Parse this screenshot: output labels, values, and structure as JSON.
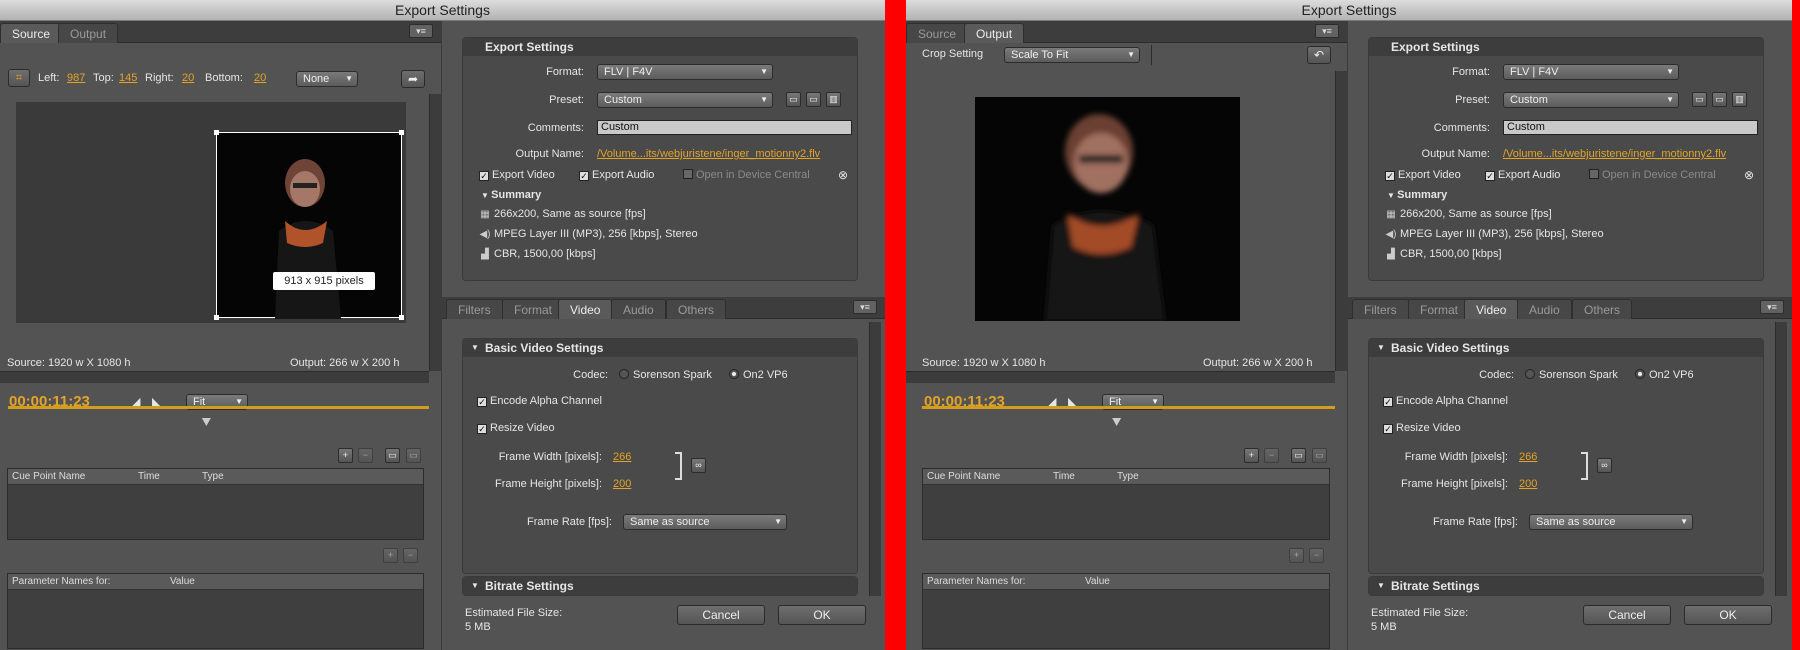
{
  "windows": [
    {
      "title": "Export Settings",
      "left_tabs": [
        "Source",
        "Output"
      ],
      "active_left_tab": 0,
      "crop": {
        "left_label": "Left:",
        "left": "987",
        "top_label": "Top:",
        "top": "145",
        "right_label": "Right:",
        "right": "20",
        "bottom_label": "Bottom:",
        "bottom": "20",
        "ratio": "None"
      },
      "crop_tooltip": "913 x 915 pixels",
      "source_info": "Source: 1920 w X 1080 h",
      "output_info": "Output: 266 w X 200 h",
      "timecode": "00;00;11;23",
      "zoom": "Fit",
      "playhead_position": 0.47,
      "cue_headers": [
        "Cue Point Name",
        "Time",
        "Type"
      ],
      "param_headers": [
        "Parameter Names for:",
        "Value"
      ],
      "export_settings": {
        "header": "Export Settings",
        "format_label": "Format:",
        "format": "FLV | F4V",
        "preset_label": "Preset:",
        "preset": "Custom",
        "comments_label": "Comments:",
        "comments": "Custom",
        "output_name_label": "Output Name:",
        "output_name": "/Volume...its/webjuristene/inger_motionny2.flv",
        "export_video": "Export Video",
        "export_audio": "Export Audio",
        "device_central": "Open in Device Central",
        "summary_label": "Summary",
        "summary": [
          "266x200, Same as source [fps]",
          "MPEG Layer III (MP3), 256 [kbps], Stereo",
          "CBR, 1500,00 [kbps]"
        ]
      },
      "right_tabs": [
        "Filters",
        "Format",
        "Video",
        "Audio",
        "Others"
      ],
      "active_right_tab": 2,
      "video": {
        "header": "Basic Video Settings",
        "codec_label": "Codec:",
        "codec_options": [
          "Sorenson Spark",
          "On2 VP6"
        ],
        "alpha": "Encode Alpha Channel",
        "resize": "Resize Video",
        "width_label": "Frame Width [pixels]:",
        "width": "266",
        "height_label": "Frame Height [pixels]:",
        "height": "200",
        "rate_label": "Frame Rate [fps]:",
        "rate": "Same as source",
        "bitrate_header": "Bitrate Settings"
      },
      "footer": {
        "size_label": "Estimated File Size:",
        "size": "5 MB",
        "cancel": "Cancel",
        "ok": "OK"
      }
    },
    {
      "title": "Export Settings",
      "left_tabs": [
        "Source",
        "Output"
      ],
      "active_left_tab": 1,
      "crop_setting_label": "Crop Setting",
      "crop_setting": "Scale To Fit",
      "source_info": "Source: 1920 w X 1080 h",
      "output_info": "Output: 266 w X 200 h",
      "timecode": "00;00;11;23",
      "zoom": "Fit",
      "playhead_position": 0.47,
      "cue_headers": [
        "Cue Point Name",
        "Time",
        "Type"
      ],
      "param_headers": [
        "Parameter Names for:",
        "Value"
      ],
      "export_settings": {
        "header": "Export Settings",
        "format_label": "Format:",
        "format": "FLV | F4V",
        "preset_label": "Preset:",
        "preset": "Custom",
        "comments_label": "Comments:",
        "comments": "Custom",
        "output_name_label": "Output Name:",
        "output_name": "/Volume...its/webjuristene/inger_motionny2.flv",
        "export_video": "Export Video",
        "export_audio": "Export Audio",
        "device_central": "Open in Device Central",
        "summary_label": "Summary",
        "summary": [
          "266x200, Same as source [fps]",
          "MPEG Layer III (MP3), 256 [kbps], Stereo",
          "CBR, 1500,00 [kbps]"
        ]
      },
      "right_tabs": [
        "Filters",
        "Format",
        "Video",
        "Audio",
        "Others"
      ],
      "active_right_tab": 2,
      "video": {
        "header": "Basic Video Settings",
        "codec_label": "Codec:",
        "codec_options": [
          "Sorenson Spark",
          "On2 VP6"
        ],
        "alpha": "Encode Alpha Channel",
        "resize": "Resize Video",
        "width_label": "Frame Width [pixels]:",
        "width": "266",
        "height_label": "Frame Height [pixels]:",
        "height": "200",
        "rate_label": "Frame Rate [fps]:",
        "rate": "Same as source",
        "bitrate_header": "Bitrate Settings"
      },
      "footer": {
        "size_label": "Estimated File Size:",
        "size": "5 MB",
        "cancel": "Cancel",
        "ok": "OK"
      }
    }
  ],
  "colors": {
    "divider": "#ff0000",
    "accent": "#e3a327",
    "panel": "#535353"
  }
}
